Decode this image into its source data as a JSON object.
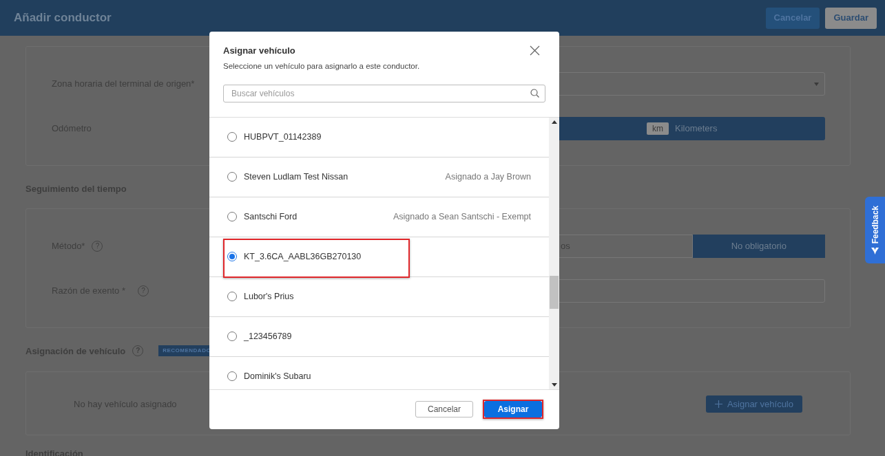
{
  "header": {
    "title": "Añadir conductor",
    "buttons": [
      {
        "label": "Cancelar",
        "kind": "secondary"
      },
      {
        "label": "Guardar",
        "kind": "primary"
      }
    ]
  },
  "home_terminal": {
    "label": "Zona horaria del terminal de origen*"
  },
  "odometer": {
    "label": "Odómetro",
    "unit_badge": "km",
    "unit_label": "Kilometers"
  },
  "time_tracking": {
    "heading": "Seguimiento del tiempo",
    "method": {
      "label": "Método*",
      "help": "?",
      "options": [
        {
          "label": "os",
          "selected": false
        },
        {
          "label": "No obligatorio",
          "selected": true
        }
      ]
    },
    "exempt_reason": {
      "label": "Razón de exento *",
      "help": "?"
    }
  },
  "vehicle_assignment": {
    "heading": "Asignación de vehículo",
    "help": "?",
    "badge": "RECOMENDADO",
    "empty_text": "No hay vehículo asignado",
    "button": "Asignar vehículo"
  },
  "next_heading": "Identificación",
  "feedback": {
    "label": "Feedback"
  },
  "modal": {
    "title": "Asignar vehículo",
    "subtitle": "Seleccione un vehículo para asignarlo a este conductor.",
    "search": {
      "placeholder": "Buscar vehículos"
    },
    "vehicles": [
      {
        "name": "HUBPVT_01142389",
        "selected": false,
        "highlighted": false
      },
      {
        "name": "Steven Ludlam Test Nissan",
        "assigned_to": "Asignado a Jay Brown",
        "selected": false,
        "highlighted": false
      },
      {
        "name": "Santschi Ford",
        "assigned_to": "Asignado a Sean Santschi - Exempt",
        "selected": false,
        "highlighted": false
      },
      {
        "name": "KT_3.6CA_AABL36GB270130",
        "selected": true,
        "highlighted": true
      },
      {
        "name": "Lubor's Prius",
        "selected": false,
        "highlighted": false
      },
      {
        "name": "_123456789",
        "selected": false,
        "highlighted": false
      },
      {
        "name": "Dominik's Subaru",
        "selected": false,
        "highlighted": false
      }
    ],
    "buttons": [
      {
        "label": "Cancelar",
        "kind": "secondary",
        "highlighted": false
      },
      {
        "label": "Asignar",
        "kind": "primary",
        "highlighted": true
      }
    ]
  }
}
